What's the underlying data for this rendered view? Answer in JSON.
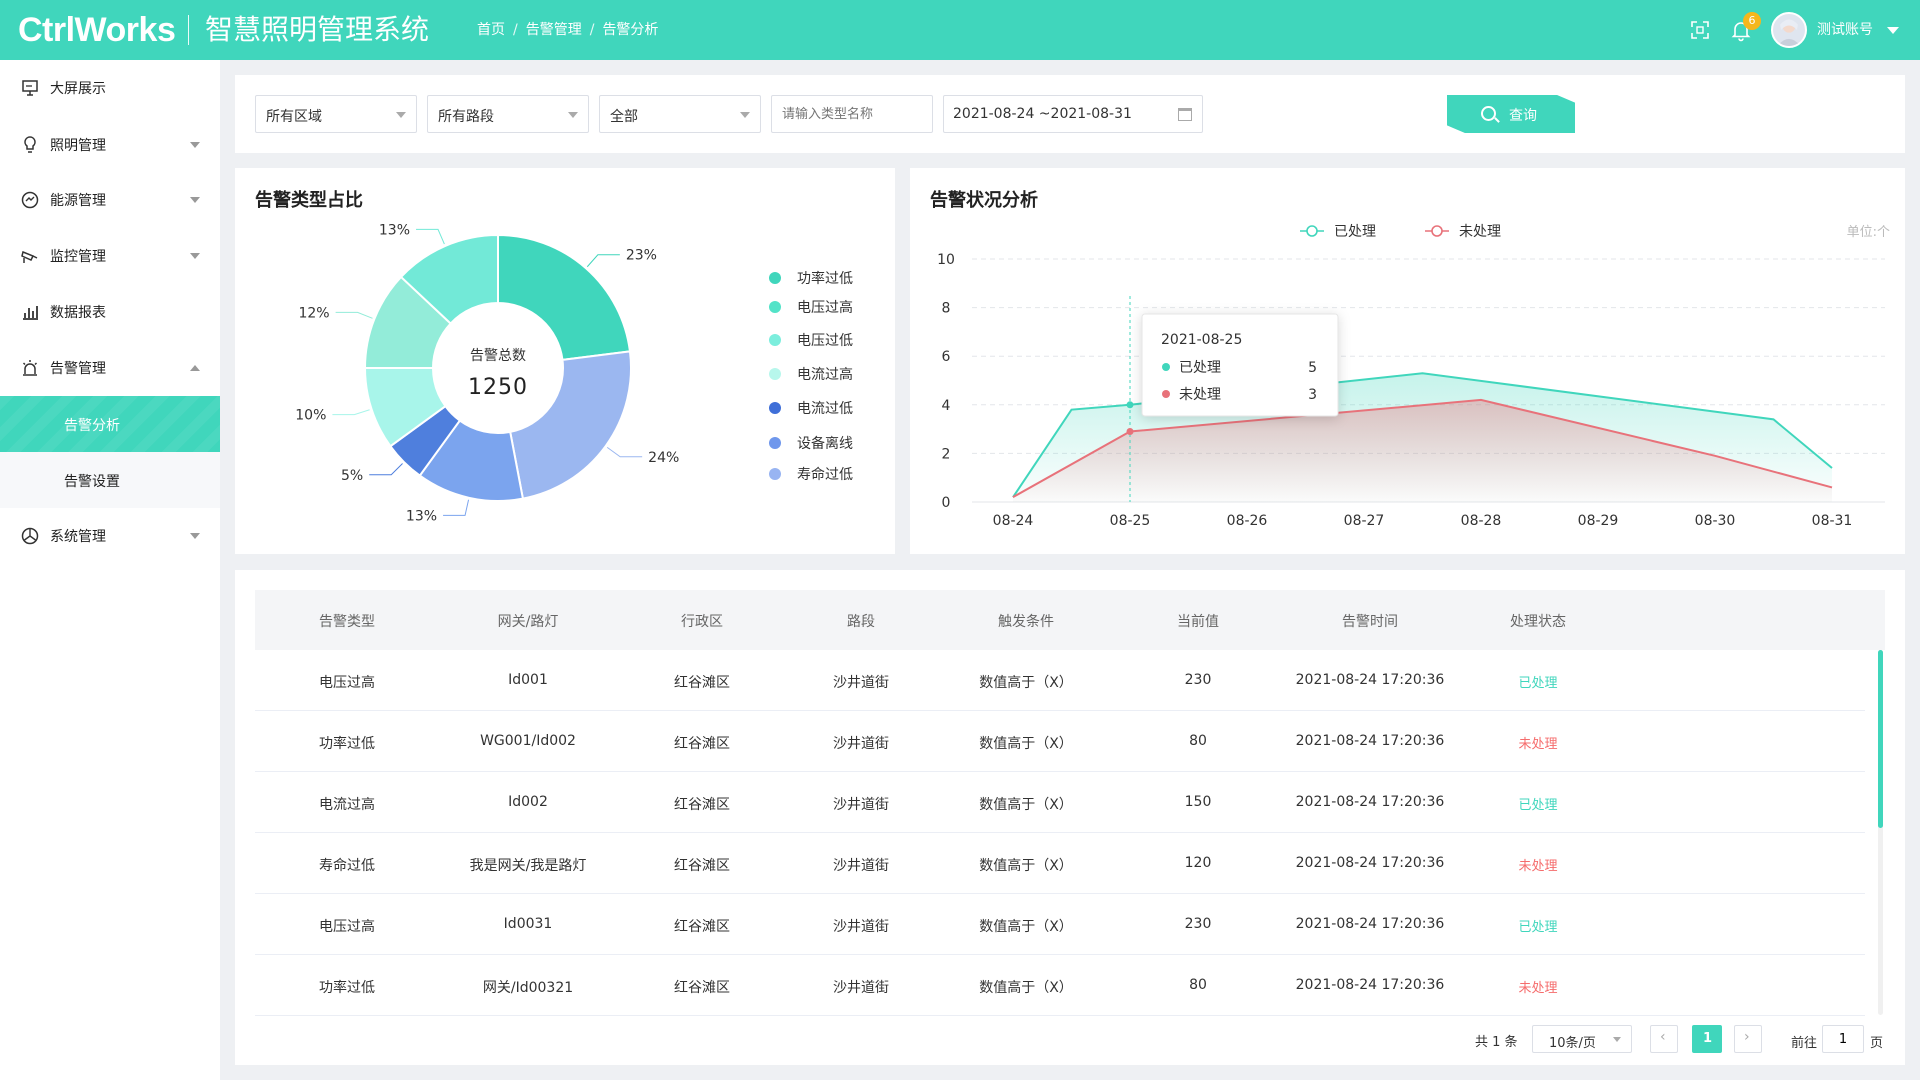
{
  "header": {
    "logo": "CtrlWorks",
    "title": "智慧照明管理系统",
    "breadcrumb": [
      "首页",
      "告警管理",
      "告警分析"
    ],
    "notification_count": "6",
    "user_name": "测试账号"
  },
  "sidebar": {
    "items": [
      {
        "label": "大屏展示",
        "icon": "monitor-icon"
      },
      {
        "label": "照明管理",
        "icon": "bulb-icon"
      },
      {
        "label": "能源管理",
        "icon": "energy-icon"
      },
      {
        "label": "监控管理",
        "icon": "camera-icon"
      },
      {
        "label": "数据报表",
        "icon": "bar-chart-icon"
      },
      {
        "label": "告警管理",
        "icon": "alarm-icon"
      },
      {
        "label": "系统管理",
        "icon": "system-icon"
      }
    ],
    "sub_items": [
      {
        "label": "告警分析",
        "active": true
      },
      {
        "label": "告警设置",
        "active": false
      }
    ]
  },
  "filters": {
    "region": "所有区域",
    "road": "所有路段",
    "status": "全部",
    "type_placeholder": "请输入类型名称",
    "date_range": "2021-08-24 ~2021-08-31",
    "query_label": "查询"
  },
  "pie_panel": {
    "title": "告警类型占比",
    "center_label": "告警总数",
    "center_value": "1250"
  },
  "line_panel": {
    "title": "告警状况分析",
    "unit": "单位:个",
    "tooltip": {
      "date": "2021-08-25",
      "rows": [
        {
          "name": "已处理",
          "value": "5"
        },
        {
          "name": "未处理",
          "value": "3"
        }
      ]
    }
  },
  "chart_data": [
    {
      "type": "pie",
      "title": "告警类型占比",
      "categories": [
        "功率过低",
        "电压过高",
        "电压过低",
        "电流过高",
        "电流过低",
        "设备离线",
        "寿命过低"
      ],
      "values": [
        23,
        24,
        13,
        5,
        10,
        12,
        13
      ],
      "labels": [
        "23%",
        "24%",
        "13%",
        "5%",
        "10%",
        "12%",
        "13%"
      ],
      "colors": [
        "#40d6bc",
        "#9bb7f0",
        "#7ba4ee",
        "#4f7fdd",
        "#a8f5ea",
        "#93ecd9",
        "#72e9d7"
      ],
      "legend_colors": [
        "#40d6bc",
        "#53e3c8",
        "#7ceedd",
        "#b7f7ec",
        "#3f6fd8",
        "#6f97ec",
        "#98b4f2"
      ]
    },
    {
      "type": "area",
      "title": "告警状况分析",
      "categories": [
        "08-24",
        "08-25",
        "08-26",
        "08-27",
        "08-28",
        "08-29",
        "08-30",
        "08-31"
      ],
      "series": [
        {
          "name": "已处理",
          "color": "#40d6bc",
          "values": [
            0.2,
            4.0,
            4.6,
            5.2,
            4.7,
            4.1,
            3.3,
            1.4
          ],
          "knots": [
            [
              0,
              0.2
            ],
            [
              0.5,
              3.8
            ],
            [
              1,
              4.0
            ],
            [
              3.5,
              5.3
            ],
            [
              6.5,
              3.4
            ],
            [
              7,
              1.4
            ]
          ]
        },
        {
          "name": "未处理",
          "color": "#e8727a",
          "values": [
            0.2,
            2.9,
            3.4,
            3.9,
            4.1,
            3.0,
            1.9,
            0.6
          ],
          "knots": [
            [
              0,
              0.2
            ],
            [
              1,
              2.9
            ],
            [
              4,
              4.2
            ],
            [
              6,
              1.9
            ],
            [
              7,
              0.6
            ]
          ]
        }
      ],
      "ylim": [
        0,
        10
      ],
      "yticks": [
        0,
        2,
        4,
        6,
        8,
        10
      ],
      "legend": "top-center",
      "grid": true,
      "unit": "单位:个"
    }
  ],
  "table": {
    "columns": [
      "告警类型",
      "网关/路灯",
      "行政区",
      "路段",
      "触发条件",
      "当前值",
      "告警时间",
      "处理状态"
    ],
    "rows": [
      {
        "type": "电压过高",
        "device": "Id001",
        "district": "红谷滩区",
        "road": "沙井道街",
        "condition": "数值高于（X）",
        "value": "230",
        "time": "2021-08-24  17:20:36",
        "status": "已处理",
        "status_class": "ok"
      },
      {
        "type": "功率过低",
        "device": "WG001/Id002",
        "district": "红谷滩区",
        "road": "沙井道街",
        "condition": "数值高于（X）",
        "value": "80",
        "time": "2021-08-24  17:20:36",
        "status": "未处理",
        "status_class": "no"
      },
      {
        "type": "电流过高",
        "device": "Id002",
        "district": "红谷滩区",
        "road": "沙井道街",
        "condition": "数值高于（X）",
        "value": "150",
        "time": "2021-08-24  17:20:36",
        "status": "已处理",
        "status_class": "ok"
      },
      {
        "type": "寿命过低",
        "device": "我是网关/我是路灯",
        "district": "红谷滩区",
        "road": "沙井道街",
        "condition": "数值高于（X）",
        "value": "120",
        "time": "2021-08-24  17:20:36",
        "status": "未处理",
        "status_class": "no"
      },
      {
        "type": "电压过高",
        "device": "Id0031",
        "district": "红谷滩区",
        "road": "沙井道街",
        "condition": "数值高于（X）",
        "value": "230",
        "time": "2021-08-24  17:20:36",
        "status": "已处理",
        "status_class": "ok"
      },
      {
        "type": "功率过低",
        "device": "网关/Id00321",
        "district": "红谷滩区",
        "road": "沙井道街",
        "condition": "数值高于（X）",
        "value": "80",
        "time": "2021-08-24  17:20:36",
        "status": "未处理",
        "status_class": "no"
      }
    ]
  },
  "pagination": {
    "total": "共 1 条",
    "page_size": "10条/页",
    "current_page": "1",
    "goto_label": "前往",
    "goto_value": "1",
    "page_suffix": "页"
  },
  "colors": {
    "accent": "#40d6bc",
    "danger": "#f56c6c",
    "badge": "#f5b71c"
  }
}
